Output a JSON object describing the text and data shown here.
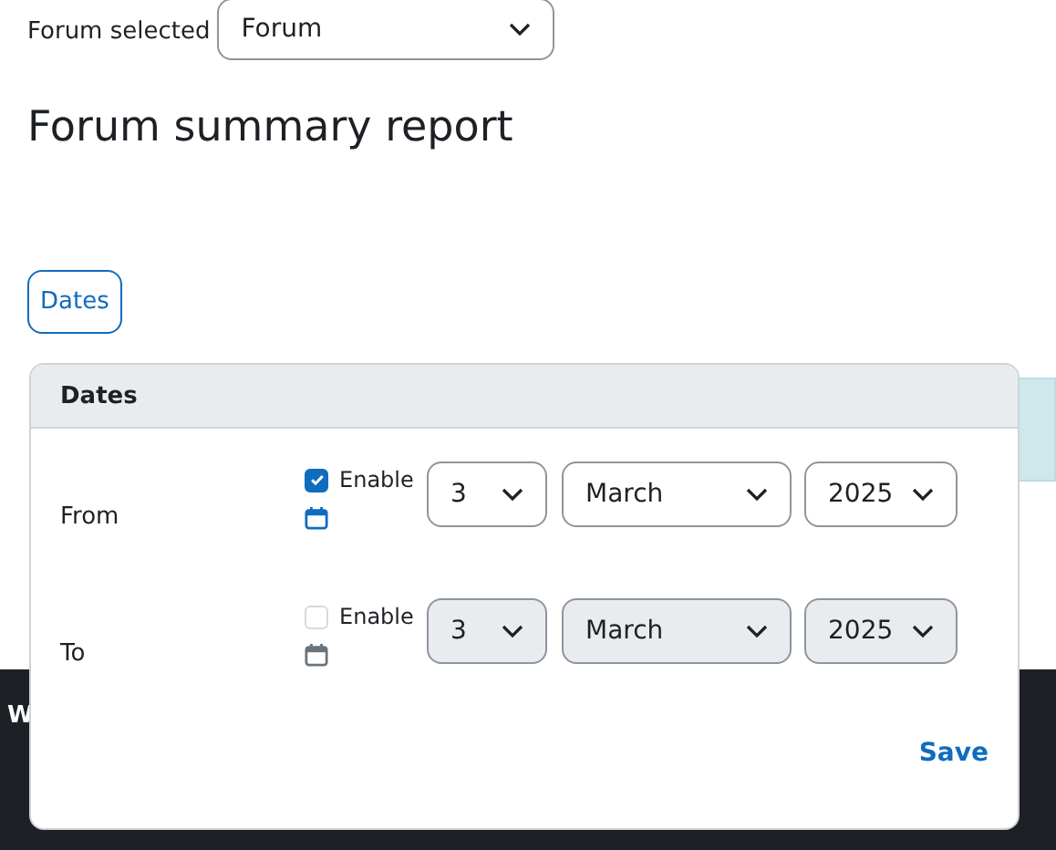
{
  "forum_selector": {
    "label": "Forum selected",
    "value": "Forum"
  },
  "title": "Forum summary report",
  "dates_button": "Dates",
  "footer_text": "W",
  "popover": {
    "title": "Dates",
    "rows": [
      {
        "label": "From",
        "enable_label": "Enable",
        "enabled": true,
        "day": "3",
        "month": "March",
        "year": "2025"
      },
      {
        "label": "To",
        "enable_label": "Enable",
        "enabled": false,
        "day": "3",
        "month": "March",
        "year": "2025"
      }
    ],
    "save": "Save"
  }
}
